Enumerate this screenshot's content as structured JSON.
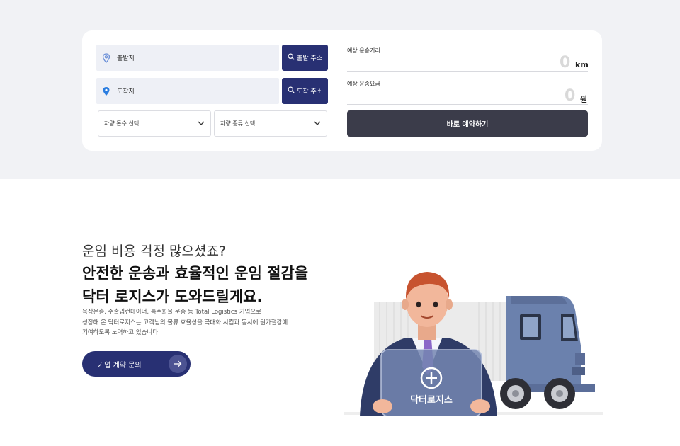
{
  "booking": {
    "origin_placeholder": "출발지",
    "origin_button": "출발 주소",
    "destination_placeholder": "도착지",
    "destination_button": "도착 주소",
    "tonnage_select": "차량 톤수 선택",
    "vehicle_type_select": "차량 종류 선택",
    "distance_label": "예상 운송거리",
    "distance_value": "0",
    "distance_unit": "km",
    "fee_label": "예상 운송요금",
    "fee_value": "0",
    "fee_unit": "원",
    "reserve_button": "바로 예약하기"
  },
  "hero": {
    "subtitle": "운임 비용 걱정 많으셨죠?",
    "title_line1": "안전한 운송과 효율적인 운임 절감을",
    "title_line2": "닥터 로지스가 도와드릴게요.",
    "desc_line1": "육상운송, 수출입컨테이너, 특수화물 운송 등 Total Logistics 기업으로",
    "desc_line2": "성장해 온 닥터로지스는 고객님의 물류 효율성을 극대화 시킴과 동시에 원가절감에",
    "desc_line3": "기여하도록 노력하고 있습니다.",
    "contact_button": "기업 계약 문의",
    "panel_brand": "닥터로지스"
  },
  "colors": {
    "navy": "#283073",
    "dark_button": "#3b3c4a",
    "band_bg": "#f1f2f5",
    "pin_origin": "#6a8fd8",
    "pin_destination": "#2b7de0"
  },
  "icons": {
    "origin_pin": "location-pin-outline-icon",
    "destination_pin": "location-pin-filled-icon",
    "search": "search-icon",
    "chevron": "chevron-down-icon",
    "arrow": "arrow-right-icon"
  }
}
